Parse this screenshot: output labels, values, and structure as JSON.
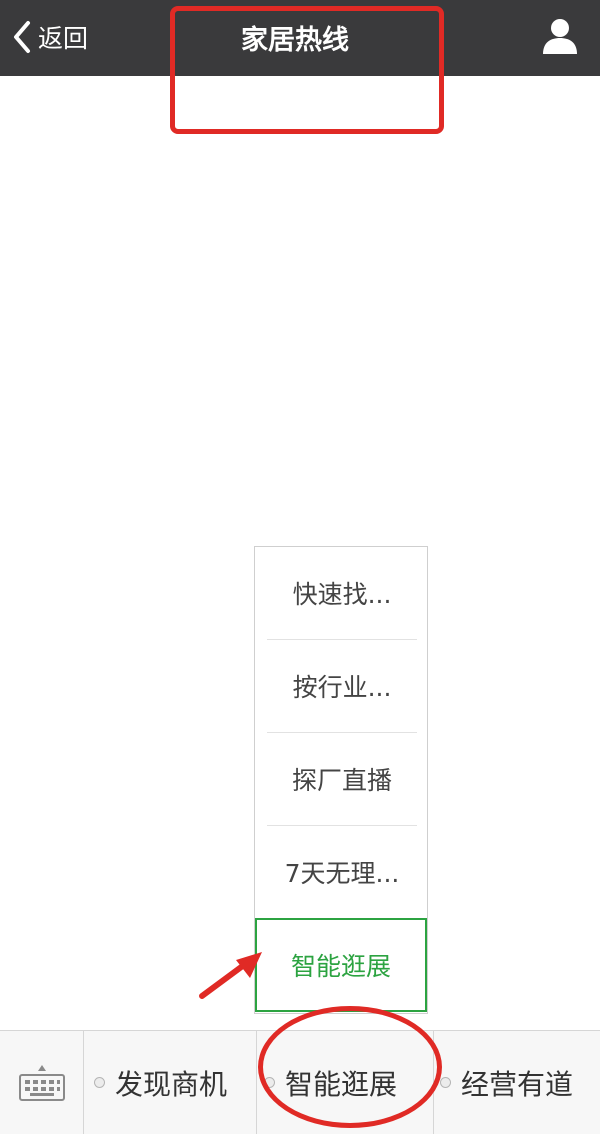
{
  "header": {
    "back_label": "返回",
    "title": "家居热线"
  },
  "submenu": {
    "items": [
      {
        "label": "快速找..."
      },
      {
        "label": "按行业..."
      },
      {
        "label": "探厂直播"
      },
      {
        "label": "7天无理..."
      }
    ],
    "active_label": "智能逛展"
  },
  "menubar": {
    "tabs": [
      {
        "label": "发现商机"
      },
      {
        "label": "智能逛展"
      },
      {
        "label": "经营有道"
      }
    ]
  },
  "colors": {
    "header_bg": "#3a3a3c",
    "active_green": "#2ca341",
    "annotation_red": "#e02a25"
  },
  "icons": [
    "back-chevron-icon",
    "user-profile-icon",
    "keyboard-icon",
    "menu-dot-icon"
  ]
}
